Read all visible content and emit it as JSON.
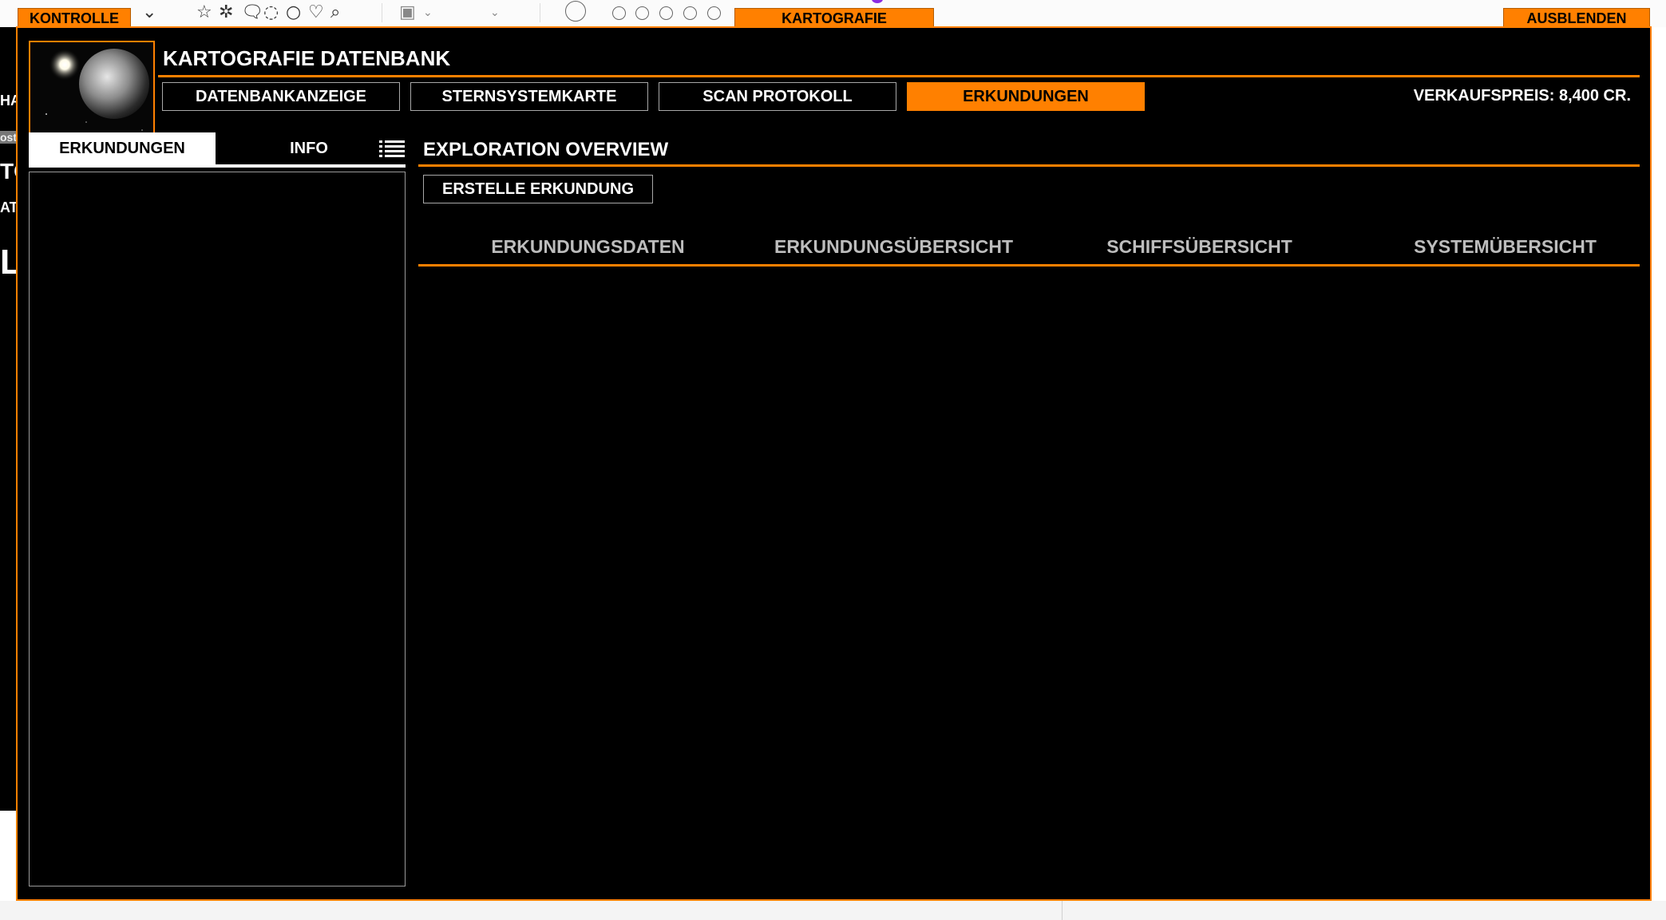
{
  "toolbar": {
    "icons": [
      "star-icon",
      "star-outline-icon",
      "speech-bubble-icon",
      "chat-bubble-icon",
      "chat-round-icon",
      "heart-icon",
      "pin-icon",
      "image-lock-icon",
      "chevron-down-icon"
    ]
  },
  "left_slice": {
    "fragments": [
      "HA",
      "ost",
      "TC",
      "AT",
      "L"
    ]
  },
  "title_tabs": {
    "kontrolle": "KONTROLLE",
    "kartografie": "KARTOGRAFIE",
    "ausblenden": "AUSBLENDEN"
  },
  "header": {
    "title": "KARTOGRAFIE DATENBANK",
    "price": "VERKAUFSPREIS: 8,400 CR."
  },
  "nav_tabs": [
    {
      "label": "DATENBANKANZEIGE",
      "active": false
    },
    {
      "label": "STERNSYSTEMKARTE",
      "active": false
    },
    {
      "label": "SCAN PROTOKOLL",
      "active": false
    },
    {
      "label": "ERKUNDUNGEN",
      "active": true
    }
  ],
  "left_panel": {
    "tabs": [
      {
        "label": "ERKUNDUNGEN",
        "active": true
      },
      {
        "label": "INFO",
        "active": false
      }
    ],
    "list_icon": "list-icon"
  },
  "main": {
    "section_title": "EXPLORATION OVERVIEW",
    "create_button": "ERSTELLE ERKUNDUNG",
    "content_tabs": [
      "ERKUNDUNGSDATEN",
      "ERKUNDUNGSÜBERSICHT",
      "SCHIFFSÜBERSICHT",
      "SYSTEMÜBERSICHT"
    ]
  },
  "colors": {
    "accent": "#ff8000",
    "background": "#000000",
    "text": "#ffffff",
    "muted_text": "#bdbdbd"
  }
}
